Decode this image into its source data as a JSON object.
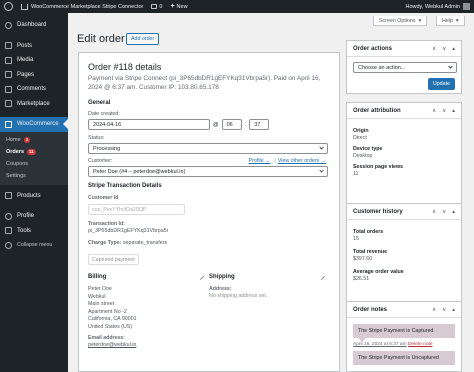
{
  "adminbar": {
    "site_name": "WooCommerce Marketplace Stripe Connector",
    "comments_count": "0",
    "new_label": "New",
    "greeting": "Howdy, Webkul Admin"
  },
  "sidebar": {
    "dashboard": "Dashboard",
    "posts": "Posts",
    "media": "Media",
    "pages": "Pages",
    "comments": "Comments",
    "marketplace": "Marketplace",
    "woocommerce": "WooCommerce",
    "sub_home": "Home",
    "sub_home_count": "3",
    "sub_orders": "Orders",
    "sub_orders_count": "11",
    "sub_coupons": "Coupons",
    "sub_settings": "Settings",
    "products": "Products",
    "profile": "Profile",
    "tools": "Tools",
    "collapse": "Collapse menu"
  },
  "header": {
    "screen_options": "Screen Options",
    "help": "Help",
    "title": "Edit order",
    "add_order": "Add order"
  },
  "order": {
    "heading": "Order #118 details",
    "meta": "Payment via Stripe Connect (pi_3P65dbDR1gEFYKq31Vbrpa5r). Paid on April 16, 2024 @ 6:37 am. Customer IP: 103.80.65.178",
    "general": "General",
    "date_label": "Date created:",
    "date_value": "2024-04-16",
    "at": "@",
    "hour": "06",
    "minute": "37",
    "status_label": "Status:",
    "status_value": "Processing",
    "customer_label": "Customer:",
    "profile_link": "Profile →",
    "other_orders_link": "View other orders →",
    "customer_value": "Peter Doe (#4 – peterdoe@webkul.in)",
    "stripe_title": "Stripe Transaction Details",
    "customer_id_label": "Customer Id",
    "customer_id_value": "cus_PvxYYhcfDa29QP",
    "transaction_label": "Transaction Id:",
    "transaction_value": "pi_3P65dbDR1gEFYKq31Vbrpa5r",
    "charge_type_label": "Charge Type:",
    "charge_type_value": "separate_transfers",
    "captured_pill": "Captured payment",
    "billing_title": "Billing",
    "billing_lines": [
      "Peter Doe",
      "Webkul",
      "Main street",
      "Apartment No -2",
      "California, CA 90001",
      "United States (US)"
    ],
    "email_label": "Email address:",
    "email_value": "peterdoe@webkul.in",
    "shipping_title": "Shipping",
    "address_label": "Address:",
    "no_shipping": "No shipping address set."
  },
  "actions": {
    "title": "Order actions",
    "choose": "Choose an action...",
    "update": "Update"
  },
  "attribution": {
    "title": "Order attribution",
    "origin_label": "Origin",
    "origin_value": "Direct",
    "device_label": "Device type",
    "device_value": "Desktop",
    "session_label": "Session page views",
    "session_value": "11"
  },
  "history": {
    "title": "Customer history",
    "total_orders_label": "Total orders",
    "total_orders_value": "15",
    "total_revenue_label": "Total revenue",
    "total_revenue_value": "$397.60",
    "avg_label": "Average order value",
    "avg_value": "$26.51"
  },
  "notes": {
    "title": "Order notes",
    "note1": "The Stripe Payment is Captured",
    "note1_date": "April 16, 2024 at 6:37 am",
    "delete": "Delete note",
    "note2": "The Stripe Payment is Uncaptured"
  },
  "box_ctrls": {
    "up": "∧",
    "down": "∨",
    "toggle": "▴"
  }
}
